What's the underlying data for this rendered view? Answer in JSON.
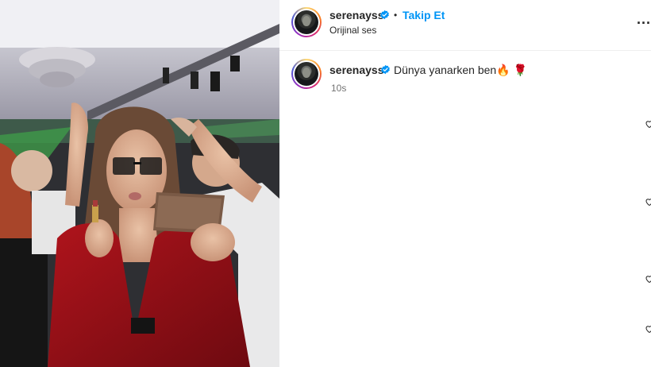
{
  "post": {
    "username": "serenayss",
    "follow_label": "Takip Et",
    "separator": "•",
    "audio_label": "Orijinal ses",
    "more_label": "...",
    "caption_username": "serenayss",
    "caption_text": "Dünya yanarken ben🔥 🌹",
    "timestamp": "10s"
  },
  "colors": {
    "follow_blue": "#0095f6",
    "verified_blue": "#0095f6",
    "text": "#262626",
    "muted": "#737373"
  },
  "icons": [
    "verified-icon",
    "more-options-icon",
    "heart-icon"
  ]
}
